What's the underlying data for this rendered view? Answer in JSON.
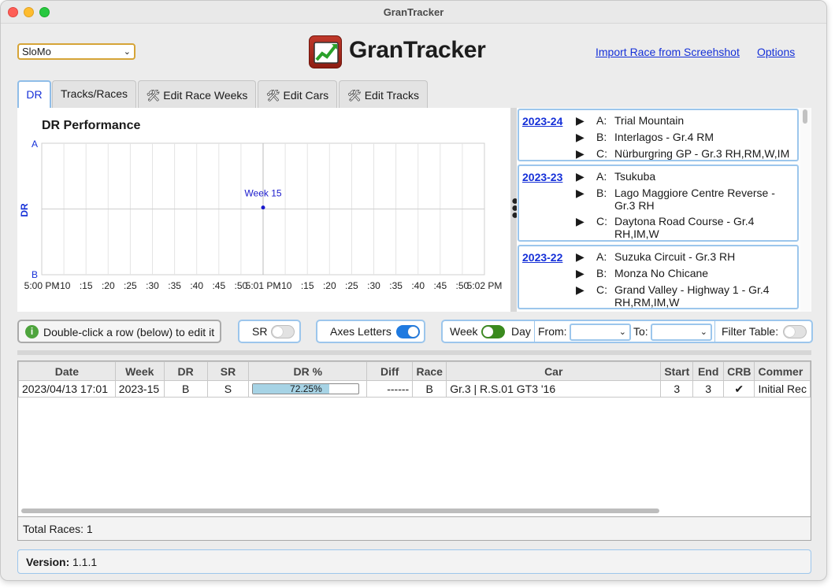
{
  "window": {
    "title": "GranTracker"
  },
  "header": {
    "account_value": "SloMo",
    "logo_text": "GranTracker",
    "import_link": "Import Race from Screehshot",
    "options_link": "Options"
  },
  "tabs": [
    {
      "label": "DR"
    },
    {
      "label": "Tracks/Races"
    },
    {
      "label": "Edit Race Weeks",
      "icon": "tools-icon"
    },
    {
      "label": "Edit Cars",
      "icon": "tools-icon"
    },
    {
      "label": "Edit Tracks",
      "icon": "tools-icon"
    }
  ],
  "chart": {
    "title": "DR Performance",
    "ylabel": "DR",
    "y_ticks": [
      "A",
      "B"
    ],
    "x_ticks": [
      "5:00 PM",
      ":10",
      ":15",
      ":20",
      ":25",
      ":30",
      ":35",
      ":40",
      ":45",
      ":50",
      "5:01 PM",
      ":10",
      ":15",
      ":20",
      ":25",
      ":30",
      ":35",
      ":40",
      ":45",
      ":50",
      "5:02 PM"
    ],
    "point_label": "Week 15"
  },
  "chart_data": {
    "type": "scatter",
    "title": "DR Performance",
    "xlabel": "",
    "ylabel": "DR",
    "series": [
      {
        "name": "Week 15",
        "x": [
          "5:01 PM"
        ],
        "y": [
          "B (72.25%)"
        ],
        "y_fraction": 0.7225
      }
    ],
    "x_range": [
      "5:00 PM",
      "5:02 PM"
    ],
    "y_range": [
      "B",
      "A"
    ],
    "grid": true
  },
  "races": [
    {
      "week": "2023-24",
      "rows": [
        {
          "letter": "A:",
          "track": "Trial Mountain"
        },
        {
          "letter": "B:",
          "track": "Interlagos - Gr.4 RM"
        },
        {
          "letter": "C:",
          "track": "Nürburgring GP - Gr.3 RH,RM,W,IM"
        }
      ]
    },
    {
      "week": "2023-23",
      "rows": [
        {
          "letter": "A:",
          "track": "Tsukuba"
        },
        {
          "letter": "B:",
          "track": "Lago Maggiore Centre Reverse - Gr.3 RH"
        },
        {
          "letter": "C:",
          "track": "Daytona Road Course - Gr.4 RH,IM,W"
        }
      ]
    },
    {
      "week": "2023-22",
      "rows": [
        {
          "letter": "A:",
          "track": "Suzuka Circuit - Gr.3 RH"
        },
        {
          "letter": "B:",
          "track": "Monza No Chicane"
        },
        {
          "letter": "C:",
          "track": "Grand Valley - Highway 1 - Gr.4 RH,RM,IM,W"
        }
      ]
    }
  ],
  "controls": {
    "hint": "Double-click a row (below) to edit it",
    "sr_label": "SR",
    "axes_label": "Axes Letters",
    "week_label": "Week",
    "day_label": "Day",
    "from_label": "From:",
    "to_label": "To:",
    "filter_label": "Filter Table:",
    "sr_on": false,
    "axes_on": true,
    "filter_on": false
  },
  "table": {
    "headers": [
      "Date",
      "Week",
      "DR",
      "SR",
      "DR %",
      "Diff",
      "Race",
      "Car",
      "Start",
      "End",
      "CRB",
      "Commer"
    ],
    "rows": [
      {
        "date": "2023/04/13 17:01",
        "week": "2023-15",
        "dr": "B",
        "sr": "S",
        "dr_pct": "72.25%",
        "dr_fraction": 0.7225,
        "diff": "------",
        "race": "B",
        "car": "Gr.3 | R.S.01 GT3 '16",
        "start": "3",
        "end": "3",
        "crb": "✔",
        "comment": "Initial Rec"
      }
    ]
  },
  "footer": {
    "total_races": "Total Races: 1",
    "version_label": "Version:",
    "version_value": "1.1.1"
  }
}
